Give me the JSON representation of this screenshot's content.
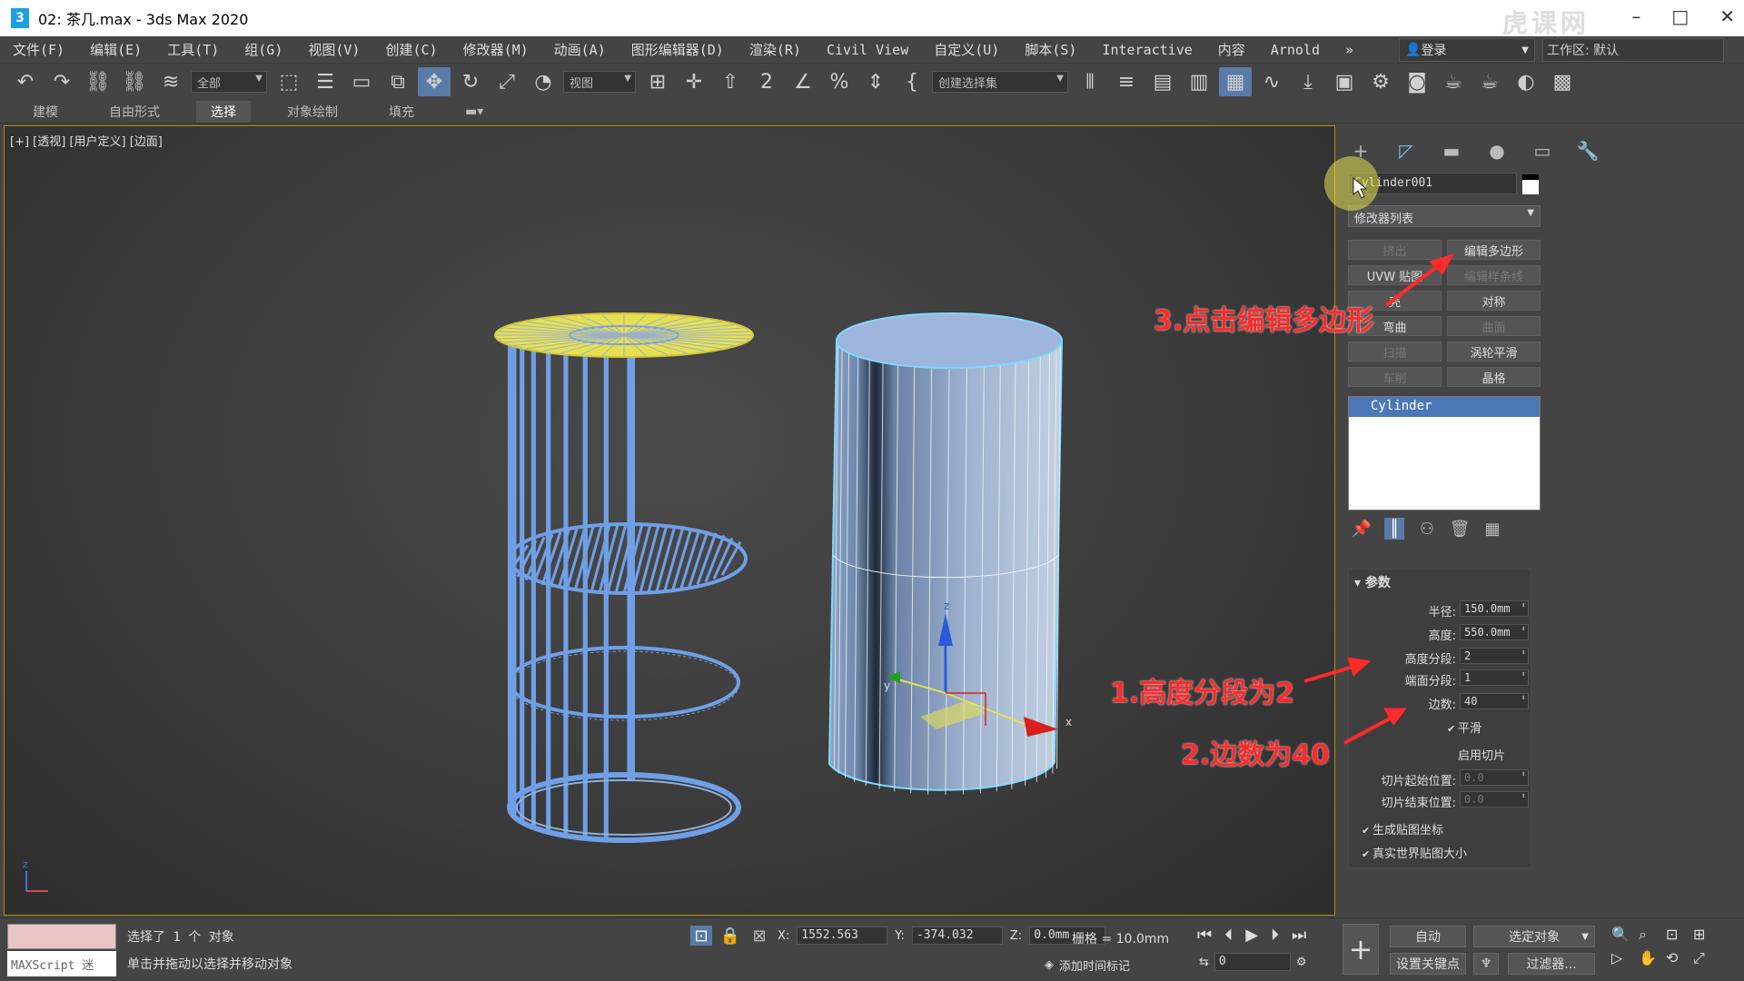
{
  "window": {
    "title": "02: 茶几.max - 3ds Max 2020",
    "app_icon": "3",
    "watermark": "虎课网"
  },
  "menu": [
    "文件(F)",
    "编辑(E)",
    "工具(T)",
    "组(G)",
    "视图(V)",
    "创建(C)",
    "修改器(M)",
    "动画(A)",
    "图形编辑器(D)",
    "渲染(R)",
    "Civil View",
    "自定义(U)",
    "脚本(S)",
    "Interactive",
    "内容",
    "Arnold"
  ],
  "menu_more": "»",
  "login": "登录",
  "workspace": "工作区: 默认",
  "toolbar": {
    "selection_filter": "全部",
    "reference_coord": "视图",
    "named_selection": "创建选择集"
  },
  "ribbon_tabs": [
    {
      "label": "建模",
      "active": false
    },
    {
      "label": "自由形式",
      "active": false
    },
    {
      "label": "选择",
      "active": true
    },
    {
      "label": "对象绘制",
      "active": false
    },
    {
      "label": "填充",
      "active": false
    }
  ],
  "viewport": {
    "label": "[+] [透视] [用户定义] [边面]",
    "gizmo_axes": [
      "x",
      "y",
      "z"
    ]
  },
  "command_panel": {
    "object_name": "Cylinder001",
    "modifier_list": "修改器列表",
    "modifier_buttons": [
      {
        "label": "挤出",
        "enabled": false
      },
      {
        "label": "编辑多边形",
        "enabled": true
      },
      {
        "label": "UVW 贴图",
        "enabled": true
      },
      {
        "label": "编辑样条线",
        "enabled": false
      },
      {
        "label": "壳",
        "enabled": true
      },
      {
        "label": "对称",
        "enabled": true
      },
      {
        "label": "弯曲",
        "enabled": true
      },
      {
        "label": "曲面",
        "enabled": false
      },
      {
        "label": "扫描",
        "enabled": false
      },
      {
        "label": "涡轮平滑",
        "enabled": true
      },
      {
        "label": "车削",
        "enabled": false
      },
      {
        "label": "晶格",
        "enabled": true
      }
    ],
    "stack_item": "Cylinder",
    "params": {
      "title": "参数",
      "radius_label": "半径:",
      "radius": "150.0mm",
      "height_label": "高度:",
      "height": "550.0mm",
      "height_segs_label": "高度分段:",
      "height_segs": "2",
      "cap_segs_label": "端面分段:",
      "cap_segs": "1",
      "sides_label": "边数:",
      "sides": "40",
      "smooth_label": "平滑",
      "smooth": true,
      "slice_on_label": "启用切片",
      "slice_on": false,
      "slice_from_label": "切片起始位置:",
      "slice_from": "0.0",
      "slice_to_label": "切片结束位置:",
      "slice_to": "0.0",
      "gen_map_label": "生成贴图坐标",
      "gen_map": true,
      "real_world_label": "真实世界贴图大小",
      "real_world": true
    }
  },
  "annotations": {
    "step1": "1.高度分段为2",
    "step2": "2.边数为40",
    "step3": "3.点击编辑多边形"
  },
  "status": {
    "maxscript": "MAXScript 迷",
    "selected": "选择了 1 个 对象",
    "hint": "单击并拖动以选择并移动对象",
    "x_label": "X:",
    "x": "1552.563",
    "y_label": "Y:",
    "y": "-374.032",
    "z_label": "Z:",
    "z": "0.0mm",
    "grid": "栅格 = 10.0mm",
    "add_time_tag": "添加时间标记",
    "frame": "0",
    "auto": "自动",
    "selected_object": "选定对象",
    "set_key": "设置关键点",
    "filters": "过滤器..."
  },
  "colors": {
    "accent": "#5a7aa8",
    "annotation": "#ff2a2a",
    "selected_wire": "#7fd9ff",
    "model_blue": "#6f9fe6",
    "model_yellow": "#e6e050"
  }
}
